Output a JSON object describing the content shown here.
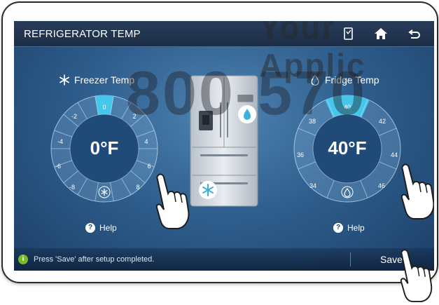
{
  "header": {
    "title": "REFRIGERATOR TEMP"
  },
  "icons": {
    "topbar": [
      "door-alarm-icon",
      "home-icon",
      "back-icon"
    ]
  },
  "freezer": {
    "label": "Freezer Temp",
    "value": "0°F",
    "selected_tick": "0",
    "ticks": [
      "0",
      "2",
      "4",
      "6",
      "8",
      "-8",
      "-6",
      "-4",
      "-2"
    ],
    "help": "Help"
  },
  "fridge": {
    "label": "Fridge Temp",
    "value": "40°F",
    "selected_tick": "40",
    "ticks": [
      "40",
      "42",
      "44",
      "46",
      "34",
      "36",
      "38"
    ],
    "help": "Help"
  },
  "footer": {
    "notice": "Press  'Save'  after setup completed.",
    "save_label": "Save"
  },
  "watermark": {
    "line1": "Your Applic",
    "line2": "800-570"
  },
  "colors": {
    "accent": "#46c6ea",
    "background": "#2f5f8e",
    "bar": "#1c2d46",
    "info": "#79b82a"
  }
}
